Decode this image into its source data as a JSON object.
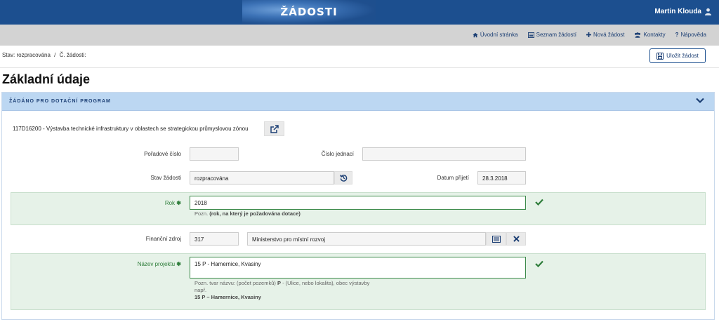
{
  "header": {
    "banner_title": "ŽÁDOSTI",
    "user_name": "Martin Klouda"
  },
  "nav": {
    "items": [
      {
        "label": "Úvodní stránka",
        "icon": "home-icon"
      },
      {
        "label": "Seznam žádostí",
        "icon": "list-icon"
      },
      {
        "label": "Nová žádost",
        "icon": "plus-icon"
      },
      {
        "label": "Kontakty",
        "icon": "contacts-icon"
      },
      {
        "label": "Nápověda",
        "icon": "help-icon"
      }
    ]
  },
  "status": {
    "state_text": "Stav: rozpracována",
    "separator": "/",
    "number_text": "Č. žádosti:"
  },
  "save_button": {
    "label": "Uložit žádost"
  },
  "page_title": "Základní údaje",
  "panel": {
    "title": "ŽÁDÁNO PRO DOTAČNÍ PROGRAM",
    "program": "117D16200 - Výstavba technické infrastruktury v oblastech se strategickou průmyslovou zónou",
    "fields": {
      "poradove_cislo": {
        "label": "Pořadové číslo",
        "value": ""
      },
      "cislo_jednaci": {
        "label": "Číslo jednací",
        "value": ""
      },
      "stav_zadosti": {
        "label": "Stav žádosti",
        "value": "rozpracována"
      },
      "datum_prijeti": {
        "label": "Datum přijetí",
        "value": "28.3.2018"
      },
      "rok": {
        "label": "Rok",
        "value": "2018",
        "note_prefix": "Pozn.",
        "note_bold": "(rok, na který je požadována dotace)"
      },
      "financni_zdroj": {
        "label": "Finanční zdroj",
        "code": "317",
        "name": "Ministerstvo pro místní rozvoj"
      },
      "nazev_projektu": {
        "label": "Název projektu",
        "value": "15 P - Hamernice, Kvasiny",
        "note_line1_a": "Pozn. tvar názvu: (počet pozemků)",
        "note_line1_b": "P",
        "note_line1_c": "- (Ulice, nebo lokalita), obec výstavby",
        "note_line2": "např.",
        "note_example": "15 P – Hamernice, Kvasiny"
      }
    }
  },
  "colors": {
    "primary": "#1c4f8f",
    "nav_bg": "#d3d3d3",
    "panel_head": "#bcd7f2",
    "valid_green": "#2e7d3a"
  }
}
